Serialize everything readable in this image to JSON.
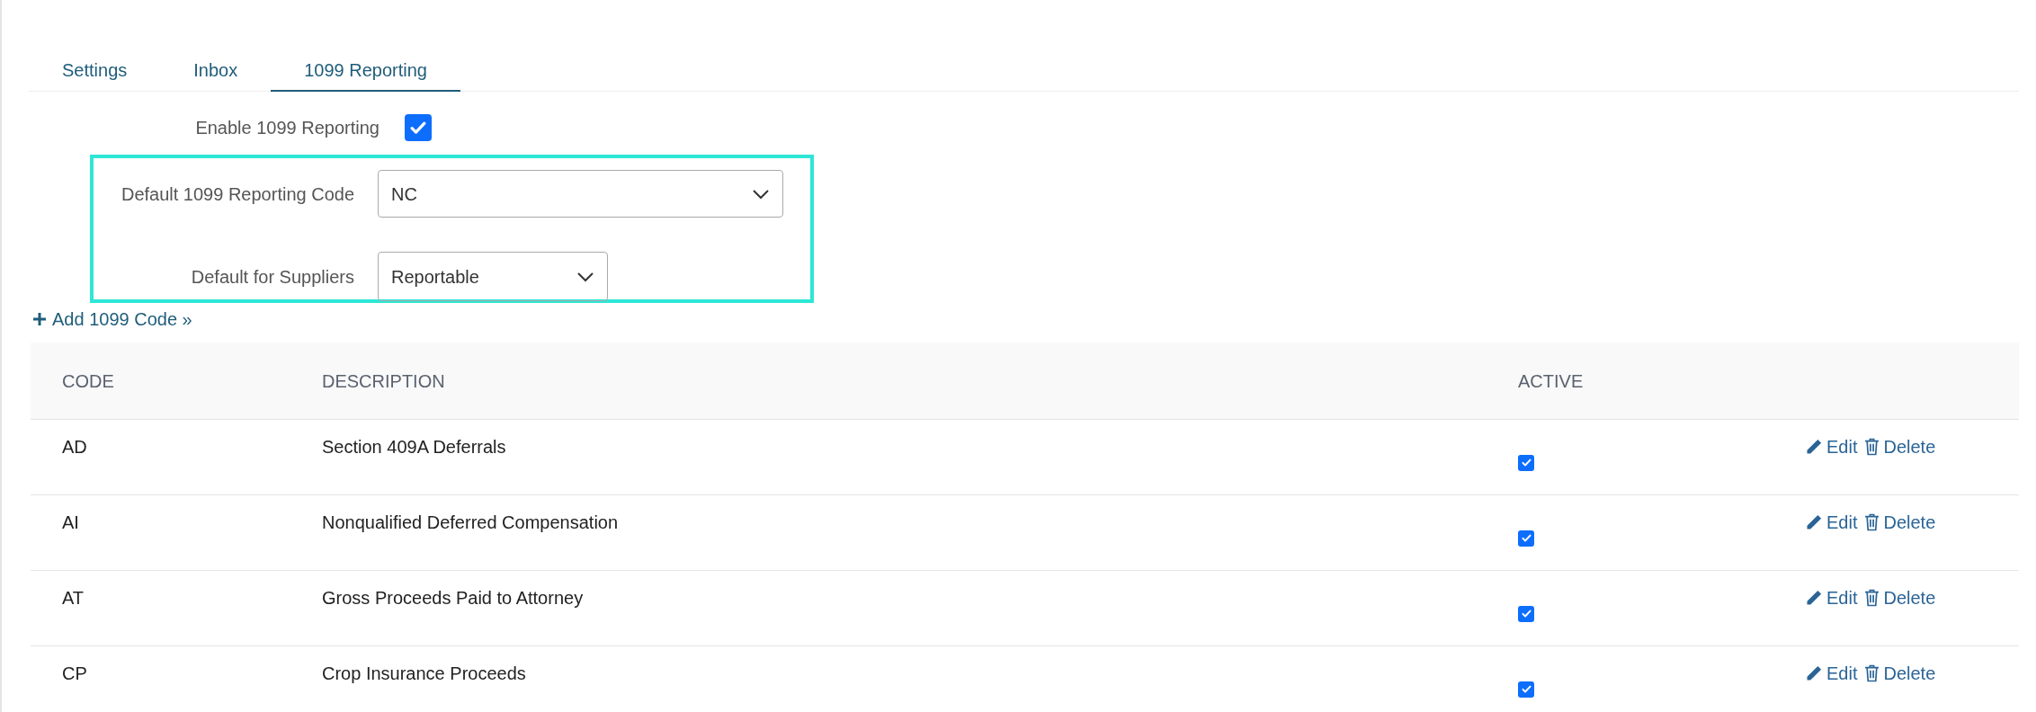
{
  "tabs": [
    {
      "label": "Settings",
      "selected": false
    },
    {
      "label": "Inbox",
      "selected": false
    },
    {
      "label": "1099 Reporting",
      "selected": true
    }
  ],
  "form": {
    "enable": {
      "label": "Enable 1099 Reporting",
      "checked": true
    },
    "highlighted": true,
    "default_code": {
      "label": "Default 1099 Reporting Code",
      "value": "NC"
    },
    "default_suppliers": {
      "label": "Default for Suppliers",
      "value": "Reportable"
    }
  },
  "add_link": "Add 1099 Code »",
  "table": {
    "columns": [
      "CODE",
      "DESCRIPTION",
      "ACTIVE"
    ],
    "rows": [
      {
        "code": "AD",
        "description": "Section 409A Deferrals",
        "active": true,
        "edit": "Edit",
        "delete": "Delete"
      },
      {
        "code": "AI",
        "description": "Nonqualified Deferred Compensation",
        "active": true,
        "edit": "Edit",
        "delete": "Delete"
      },
      {
        "code": "AT",
        "description": "Gross Proceeds Paid to Attorney",
        "active": true,
        "edit": "Edit",
        "delete": "Delete"
      },
      {
        "code": "CP",
        "description": "Crop Insurance Proceeds",
        "active": true,
        "edit": "Edit",
        "delete": "Delete"
      }
    ]
  }
}
